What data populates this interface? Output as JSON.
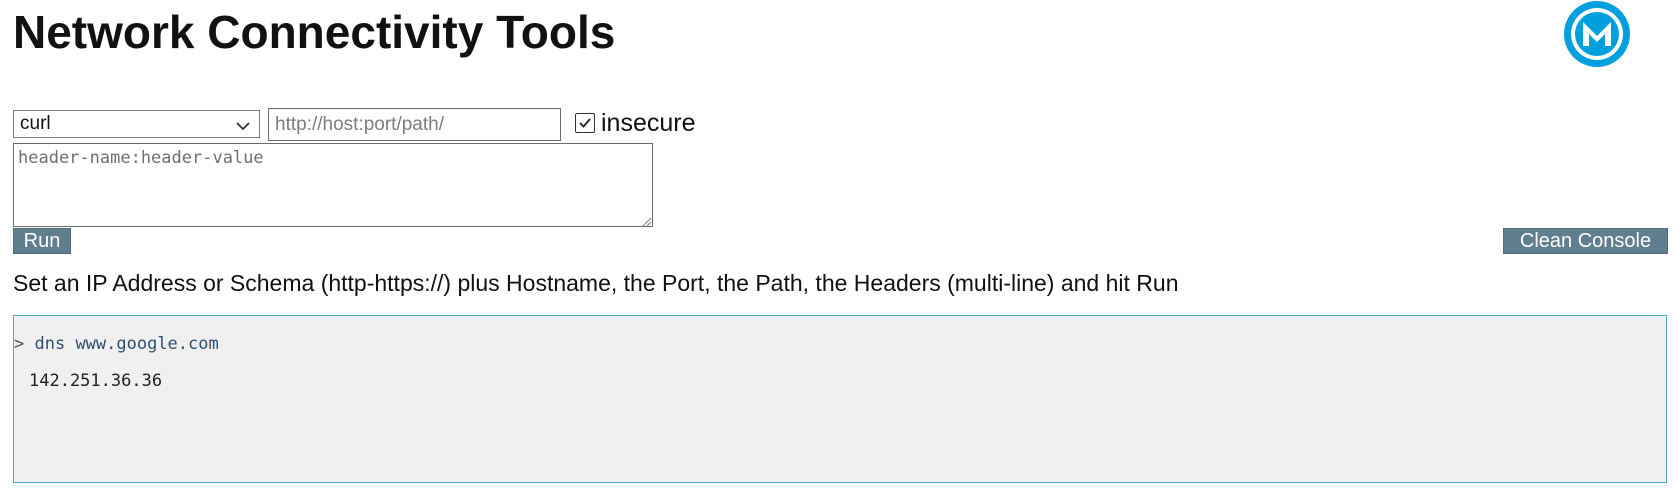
{
  "header": {
    "title": "Network Connectivity Tools"
  },
  "logo": {
    "icon": "mulesoft-logo-icon",
    "color": "#00a0df"
  },
  "form": {
    "tool_select": {
      "value": "curl",
      "icon": "chevron-down-icon"
    },
    "url": {
      "value": "",
      "placeholder": "http://host:port/path/"
    },
    "insecure": {
      "checked": true,
      "label": "insecure"
    },
    "headers": {
      "value": "",
      "placeholder": "header-name:header-value"
    },
    "run_label": "Run",
    "clean_label": "Clean Console"
  },
  "instructions": "Set an IP Address or Schema (http-https://) plus Hostname, the Port, the Path, the Headers (multi-line) and hit Run",
  "console": {
    "prompt": ">",
    "command": "dns www.google.com",
    "output": "142.251.36.36"
  },
  "colors": {
    "button_bg": "#5f7f8f",
    "console_border": "#4aa3c8",
    "console_bg": "#f0f0f0"
  }
}
